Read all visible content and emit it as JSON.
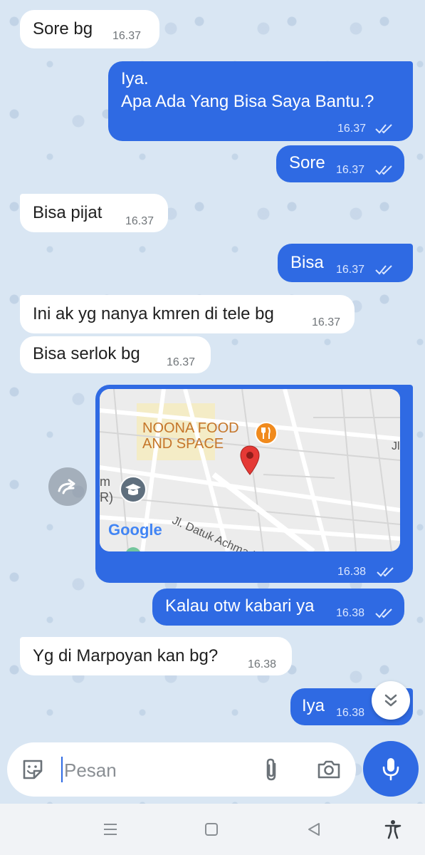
{
  "messages": [
    {
      "dir": "in",
      "text": "Sore bg",
      "time": "16.37"
    },
    {
      "dir": "out",
      "lines": [
        "Iya.",
        "Apa Ada Yang Bisa Saya Bantu.?"
      ],
      "time": "16.37",
      "status": "read"
    },
    {
      "dir": "out",
      "text": "Sore",
      "time": "16.37",
      "status": "read"
    },
    {
      "dir": "in",
      "text": "Bisa pijat",
      "time": "16.37"
    },
    {
      "dir": "out",
      "text": "Bisa",
      "time": "16.37",
      "status": "read"
    },
    {
      "dir": "in",
      "text": "Ini ak yg nanya kmren di tele bg",
      "time": "16.37"
    },
    {
      "dir": "in",
      "text": "Bisa serlok bg",
      "time": "16.37"
    },
    {
      "dir": "out",
      "type": "location",
      "time": "16.38",
      "status": "read",
      "map": {
        "place_line1": "NOONA FOOD",
        "place_line2": "AND SPACE",
        "street": "Jl. Datuk Achmad",
        "provider": "Google",
        "edge_label_left": "m",
        "edge_label_left2": "R)",
        "edge_label_right": "Jl"
      }
    },
    {
      "dir": "out",
      "text": "Kalau otw kabari ya",
      "time": "16.38",
      "status": "read"
    },
    {
      "dir": "in",
      "text": "Yg di Marpoyan kan bg?",
      "time": "16.38"
    },
    {
      "dir": "out",
      "text": "Iya",
      "time": "16.38",
      "status": "read"
    }
  ],
  "composer": {
    "placeholder": "Pesan"
  },
  "icons": {
    "sticker": "sticker-icon",
    "attach": "paperclip-icon",
    "camera": "camera-icon",
    "mic": "microphone-icon",
    "share": "forward-icon",
    "scroll_down": "double-chevron-down-icon",
    "nav": [
      "menu-icon",
      "home-square-icon",
      "back-triangle-icon",
      "accessibility-icon"
    ]
  },
  "colors": {
    "accent": "#2f6ae3",
    "background": "#d9e6f3",
    "incoming": "#ffffff"
  }
}
